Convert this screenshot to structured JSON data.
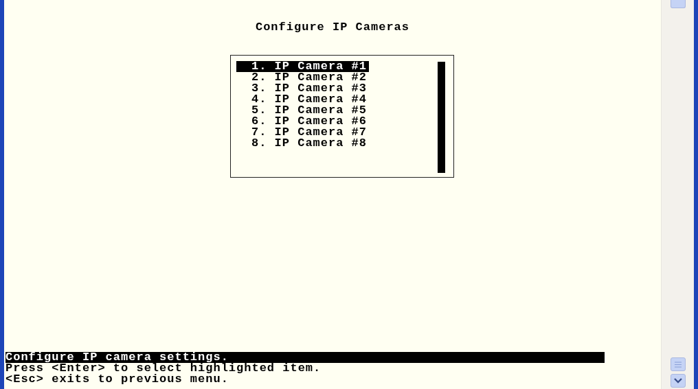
{
  "title": "Configure IP Cameras",
  "menu": {
    "items": [
      {
        "label": "1. IP Camera #1",
        "selected": true
      },
      {
        "label": "2. IP Camera #2",
        "selected": false
      },
      {
        "label": "3. IP Camera #3",
        "selected": false
      },
      {
        "label": "4. IP Camera #4",
        "selected": false
      },
      {
        "label": "5. IP Camera #5",
        "selected": false
      },
      {
        "label": "6. IP Camera #6",
        "selected": false
      },
      {
        "label": "7. IP Camera #7",
        "selected": false
      },
      {
        "label": "8. IP Camera #8",
        "selected": false
      }
    ]
  },
  "status_lines": [
    {
      "text": "Configure IP camera settings.",
      "kind": "description"
    },
    {
      "text": "Press <Enter> to select highlighted item.",
      "kind": "hint"
    },
    {
      "text": "<Esc> exits to previous menu.",
      "kind": "hint"
    }
  ]
}
